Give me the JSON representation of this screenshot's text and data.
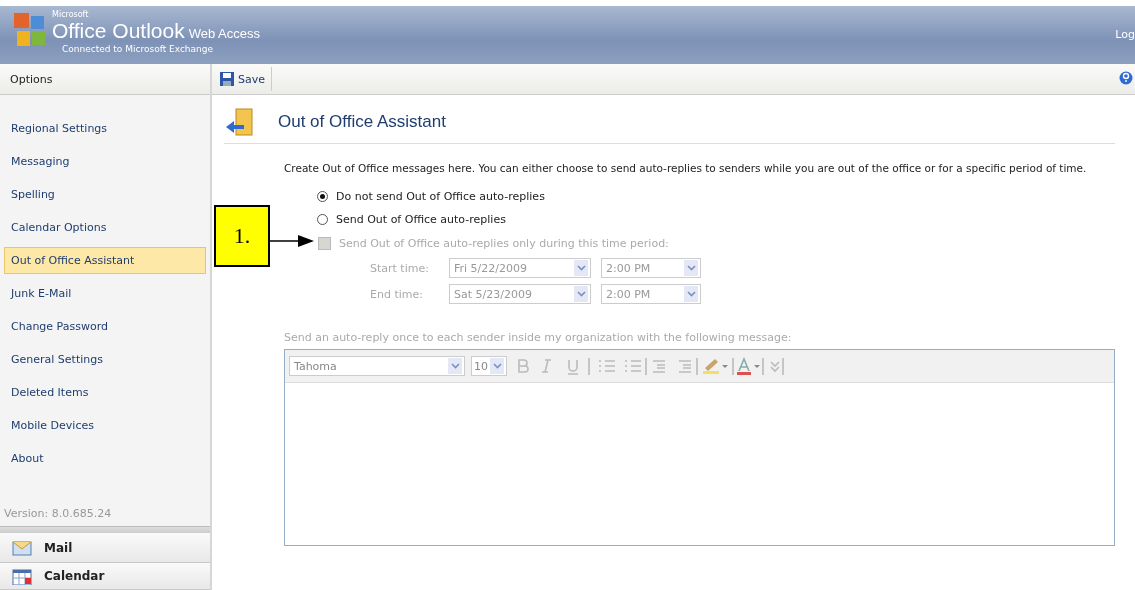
{
  "header": {
    "brand_small": "Microsoft",
    "brand": "Office Outlook",
    "brand_suffix": "Web Access",
    "subtitle": "Connected to Microsoft Exchange",
    "logout": "Log"
  },
  "sidebar": {
    "title": "Options",
    "items": [
      {
        "label": "Regional Settings",
        "selected": false
      },
      {
        "label": "Messaging",
        "selected": false
      },
      {
        "label": "Spelling",
        "selected": false
      },
      {
        "label": "Calendar Options",
        "selected": false
      },
      {
        "label": "Out of Office Assistant",
        "selected": true
      },
      {
        "label": "Junk E-Mail",
        "selected": false
      },
      {
        "label": "Change Password",
        "selected": false
      },
      {
        "label": "General Settings",
        "selected": false
      },
      {
        "label": "Deleted Items",
        "selected": false
      },
      {
        "label": "Mobile Devices",
        "selected": false
      },
      {
        "label": "About",
        "selected": false
      }
    ],
    "version": "Version: 8.0.685.24",
    "nav": [
      {
        "label": "Mail",
        "kind": "mail"
      },
      {
        "label": "Calendar",
        "kind": "calendar"
      }
    ]
  },
  "toolbar": {
    "save": "Save"
  },
  "page": {
    "title": "Out of Office Assistant",
    "intro": "Create Out of Office messages here. You can either choose to send auto-replies to senders while you are out of the office or for a specific period of time.",
    "options": [
      {
        "label": "Do not send Out of Office auto-replies",
        "selected": true
      },
      {
        "label": "Send Out of Office auto-replies",
        "selected": false
      }
    ],
    "period": {
      "label": "Send Out of Office auto-replies only during this time period:",
      "checked": false,
      "disabled": true
    },
    "times": [
      {
        "label": "Start time:",
        "date": "Fri 5/22/2009",
        "time": "2:00 PM"
      },
      {
        "label": "End time:",
        "date": "Sat 5/23/2009",
        "time": "2:00 PM"
      }
    ],
    "message_label": "Send an auto-reply once to each sender inside my organization with the following message:",
    "editor": {
      "font": "Tahoma",
      "size": "10"
    }
  },
  "callout": {
    "label": "1."
  }
}
